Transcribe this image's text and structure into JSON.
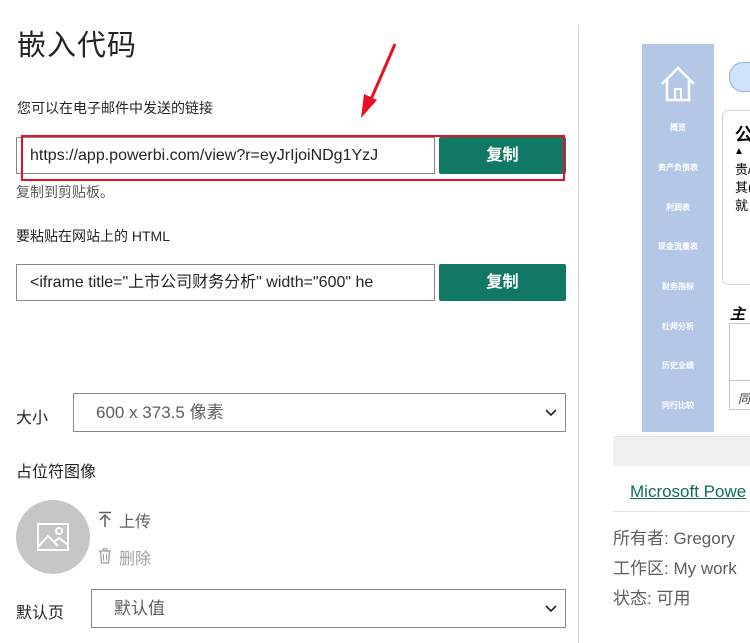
{
  "dialog": {
    "title": "嵌入代码",
    "link_section": {
      "label": "您可以在电子邮件中发送的链接",
      "value": "https://app.powerbi.com/view?r=eyJrIjoiNDg1YzJ",
      "copy_label": "复制",
      "status": "复制到剪贴板。"
    },
    "html_section": {
      "label": "要粘贴在网站上的 HTML",
      "value": "<iframe title=\"上市公司财务分析\" width=\"600\" he",
      "copy_label": "复制"
    },
    "size": {
      "label": "大小",
      "selected": "600 x 373.5 像素"
    },
    "placeholder": {
      "label": "占位符图像",
      "upload_label": "上传",
      "delete_label": "删除"
    },
    "default_page": {
      "label": "默认页",
      "selected": "默认值"
    }
  },
  "preview": {
    "nav_items": [
      "概览",
      "资产负债表",
      "利润表",
      "现金流量表",
      "财务指标",
      "杜邦分析",
      "历史业绩",
      "同行比较"
    ],
    "card_title": "公",
    "card_lines": [
      "贵/",
      "其(",
      "就"
    ],
    "section_title": "主",
    "table_cell": "同",
    "report_link": "Microsoft Powe",
    "owner": "所有者: Gregory",
    "workspace": "工作区: My work",
    "status": "状态: 可用"
  },
  "colors": {
    "accent": "#117865",
    "highlight": "#e81123",
    "nav_bg": "#b4c7e7"
  }
}
